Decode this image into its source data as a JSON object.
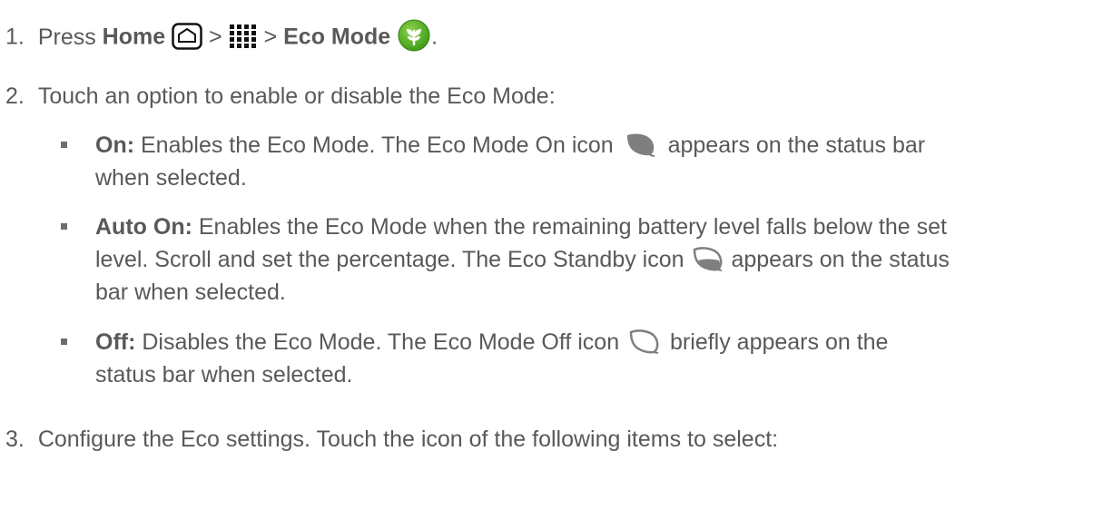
{
  "steps": [
    {
      "number": "1.",
      "press": "Press",
      "home_bold": "Home",
      "gt1": ">",
      "gt2": ">",
      "eco_bold": "Eco Mode",
      "period": "."
    },
    {
      "number": "2.",
      "text": "Touch an option to enable or disable the Eco Mode:"
    },
    {
      "number": "3.",
      "text": "Configure the Eco settings. Touch the icon of the following items to select:"
    }
  ],
  "options": [
    {
      "label": "On:",
      "line1_a": "Enables the Eco Mode. The Eco Mode On icon",
      "line1_b": "appears on the status bar",
      "line2": "when selected.",
      "icon": "leaf-filled-icon"
    },
    {
      "label": "Auto On:",
      "line1": "Enables the Eco Mode when the remaining battery level falls below the set",
      "line2_a": "level. Scroll and set the percentage. The Eco Standby icon",
      "line2_b": "appears on the status",
      "line3": "bar when selected.",
      "icon": "leaf-half-icon"
    },
    {
      "label": "Off:",
      "line1_a": "Disables the Eco Mode. The Eco Mode Off icon",
      "line1_b": "briefly appears on the",
      "line2": "status bar when selected.",
      "icon": "leaf-outline-icon"
    }
  ],
  "icons": {
    "home": "home-icon",
    "apps": "apps-grid-icon",
    "eco_app": "eco-mode-app-icon"
  },
  "colors": {
    "text": "#595959",
    "leaf_gray": "#7f7f7f",
    "eco_green": "#4caf1a"
  }
}
